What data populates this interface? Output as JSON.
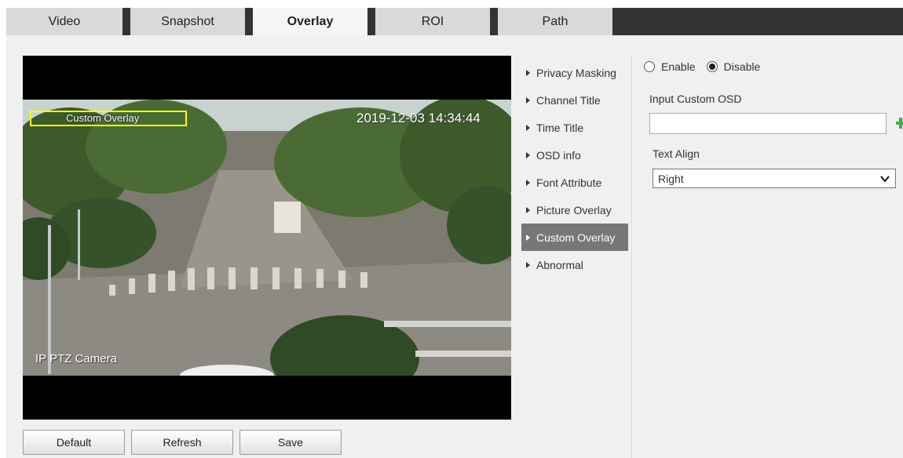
{
  "tabs": [
    {
      "label": "Video"
    },
    {
      "label": "Snapshot"
    },
    {
      "label": "Overlay"
    },
    {
      "label": "ROI"
    },
    {
      "label": "Path"
    }
  ],
  "active_tab": "Overlay",
  "preview": {
    "osd_custom_text": "Custom Overlay",
    "osd_time": "2019-12-03 14:34:44",
    "osd_channel": "IP PTZ Camera"
  },
  "buttons": {
    "default": "Default",
    "refresh": "Refresh",
    "save": "Save"
  },
  "menu": {
    "items": [
      {
        "label": "Privacy Masking"
      },
      {
        "label": "Channel Title"
      },
      {
        "label": "Time Title"
      },
      {
        "label": "OSD info"
      },
      {
        "label": "Font Attribute"
      },
      {
        "label": "Picture Overlay"
      },
      {
        "label": "Custom Overlay"
      },
      {
        "label": "Abnormal"
      }
    ],
    "active": "Custom Overlay"
  },
  "form": {
    "enable_label": "Enable",
    "disable_label": "Disable",
    "selected": "Disable",
    "osd_label": "Input Custom OSD",
    "osd_value": "",
    "align_label": "Text Align",
    "align_value": "Right"
  },
  "colors": {
    "tab_bar": "#333333",
    "menu_active": "#777777",
    "osd_box": "#ffff00",
    "plus_icon": "#3fae3f"
  },
  "icons": {
    "add": "plus-icon",
    "select": "chevron-down-icon",
    "menu_item": "triangle-right-icon"
  }
}
